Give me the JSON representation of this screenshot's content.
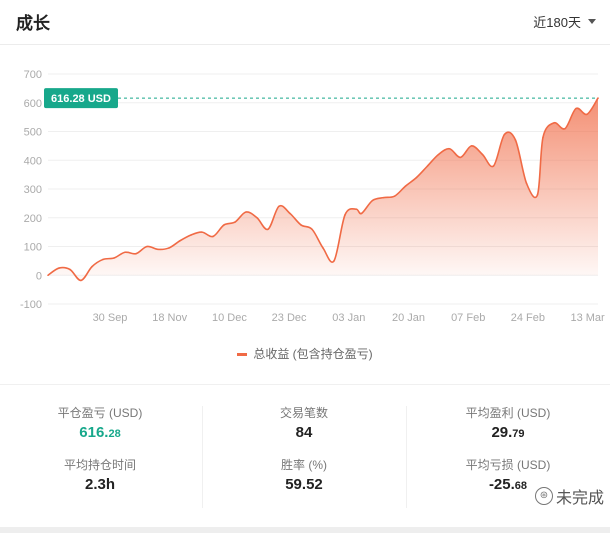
{
  "header": {
    "title": "成长",
    "range_label": "近180天"
  },
  "chart": {
    "current_value_label": "616.28 USD",
    "legend_label": "总收益 (包含持仓盈亏)",
    "line_color": "#f06a45",
    "badge_color": "#17a88b"
  },
  "chart_data": {
    "type": "area",
    "title": "",
    "xlabel": "",
    "ylabel": "",
    "ylim": [
      -100,
      700
    ],
    "y_ticks": [
      "700",
      "600",
      "500",
      "400",
      "300",
      "200",
      "100",
      "0",
      "-100"
    ],
    "x_ticks": [
      "30 Sep",
      "18 Nov",
      "10 Dec",
      "23 Dec",
      "03 Jan",
      "20 Jan",
      "07 Feb",
      "24 Feb",
      "13 Mar"
    ],
    "grid": true,
    "series": [
      {
        "name": "总收益 (包含持仓盈亏)",
        "x": [
          0,
          2,
          4,
          6,
          8,
          10,
          12,
          14,
          16,
          18,
          20,
          22,
          24,
          26,
          28,
          30,
          32,
          34,
          36,
          38,
          40,
          42,
          44,
          46,
          48,
          50,
          52,
          54,
          56,
          57,
          59,
          61,
          63,
          65,
          67,
          69,
          71,
          73,
          75,
          77,
          79,
          81,
          83,
          85,
          87,
          89,
          90,
          92,
          94,
          96,
          98,
          100
        ],
        "values": [
          0,
          25,
          20,
          -18,
          30,
          55,
          60,
          80,
          75,
          100,
          90,
          95,
          120,
          140,
          150,
          135,
          175,
          185,
          220,
          200,
          160,
          240,
          215,
          175,
          160,
          95,
          50,
          210,
          230,
          215,
          260,
          270,
          275,
          310,
          340,
          380,
          420,
          440,
          410,
          450,
          420,
          380,
          490,
          470,
          320,
          280,
          480,
          530,
          510,
          580,
          560,
          616.28
        ]
      }
    ]
  },
  "stats": {
    "closed_pnl": {
      "label": "平仓盈亏 (USD)",
      "int": "616.",
      "dec": "28"
    },
    "trade_count": {
      "label": "交易笔数",
      "value": "84"
    },
    "avg_profit": {
      "label": "平均盈利 (USD)",
      "int": "29.",
      "dec": "79"
    },
    "avg_hold": {
      "label": "平均持仓时间",
      "value": "2.3h"
    },
    "win_rate": {
      "label": "胜率 (%)",
      "value": "59.52"
    },
    "avg_loss": {
      "label": "平均亏损 (USD)",
      "int": "-25.",
      "dec": "68"
    }
  },
  "watermark": {
    "text": "未完成",
    "icon": "wechat-channel-icon"
  }
}
